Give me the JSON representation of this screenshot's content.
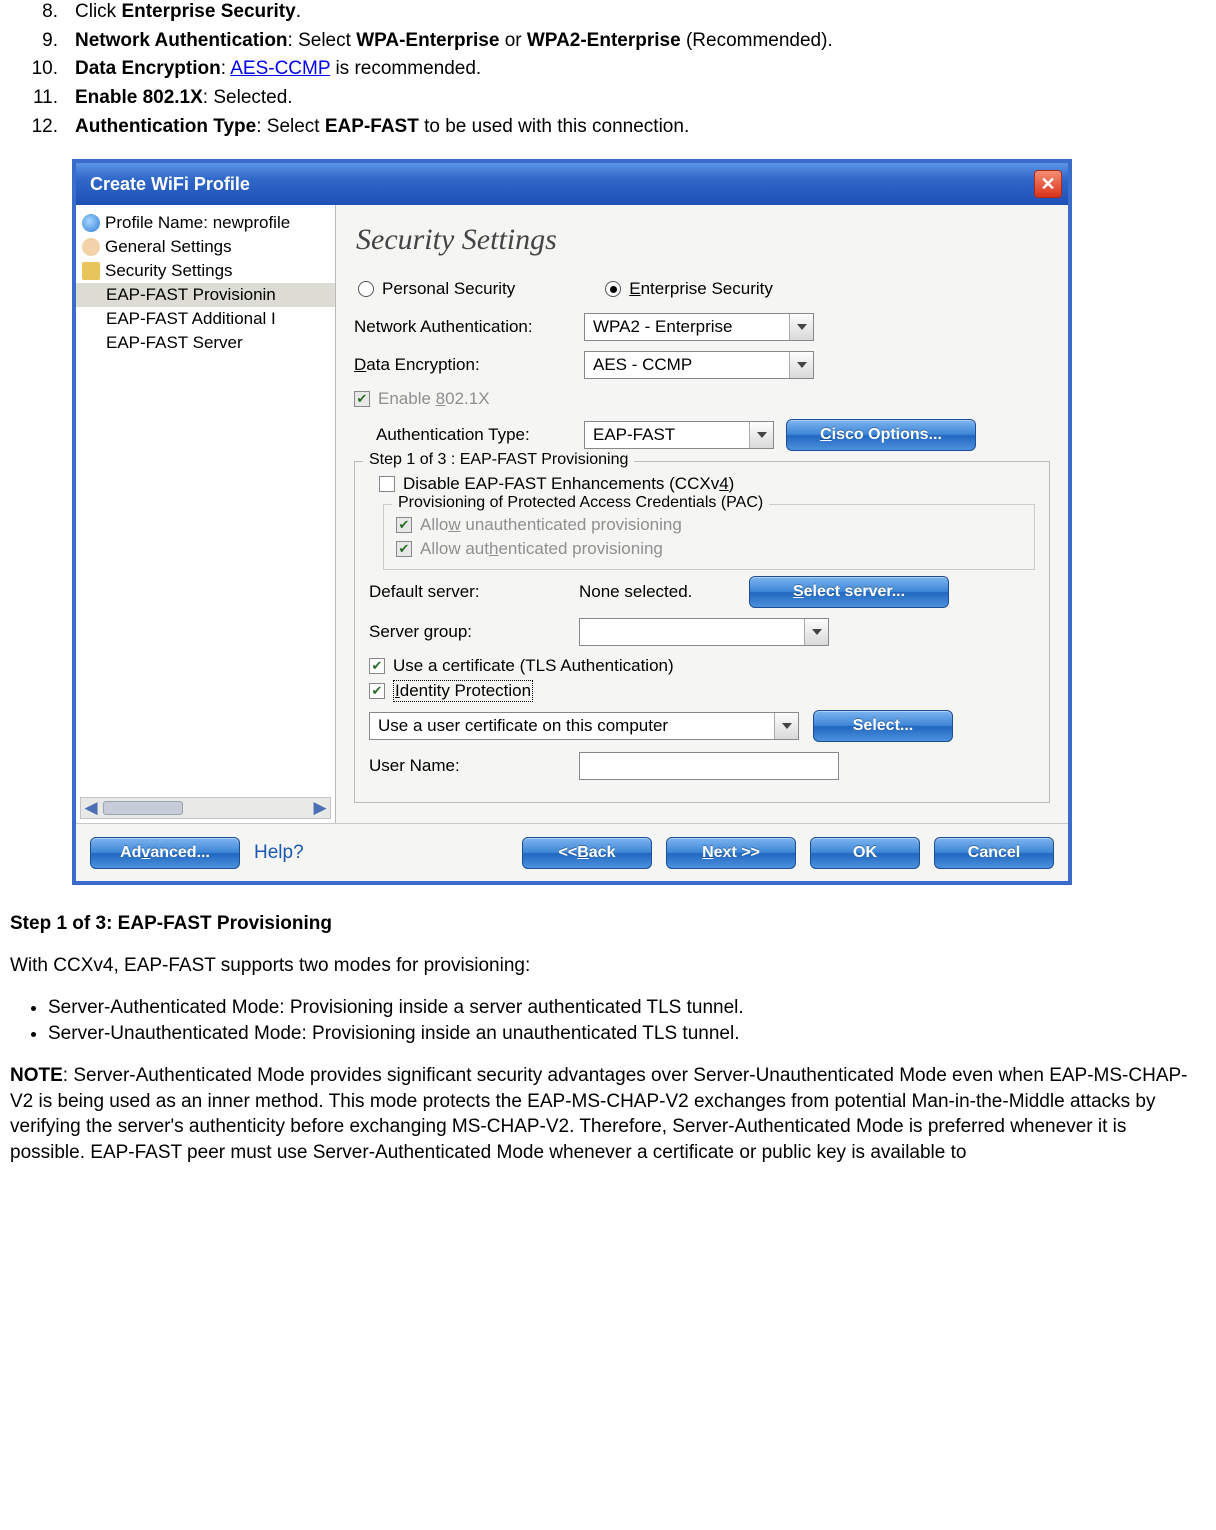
{
  "steps": {
    "s8": {
      "num": "8.",
      "pre": "Click ",
      "bold": "Enterprise Security",
      "post": "."
    },
    "s9": {
      "num": "9.",
      "bold1": "Network Authentication",
      "mid": ": Select ",
      "bold2": "WPA-Enterprise",
      "or": " or ",
      "bold3": "WPA2-Enterprise",
      "tail": " (Recommended)."
    },
    "s10": {
      "num": "10.",
      "bold": "Data Encryption",
      "mid": ": ",
      "link": "AES-CCMP",
      "tail": " is recommended."
    },
    "s11": {
      "num": "11.",
      "bold": "Enable 802.1X",
      "tail": ": Selected."
    },
    "s12": {
      "num": "12.",
      "bold1": "Authentication Type",
      "mid": ": Select ",
      "bold2": "EAP-FAST",
      "tail": " to be used with this connection."
    }
  },
  "dialog": {
    "title": "Create WiFi Profile",
    "tree": {
      "profile": "Profile Name: newprofile",
      "general": "General Settings",
      "security": "Security Settings",
      "eap_prov": "EAP-FAST Provisionin",
      "eap_add": "EAP-FAST Additional I",
      "eap_srv": "EAP-FAST Server"
    },
    "heading": "Security Settings",
    "radios": {
      "personal": "Personal Security",
      "enterprise": "Enterprise Security"
    },
    "labels": {
      "net_auth": "Network Authentication:",
      "data_enc": "Data Encryption:",
      "enable8021x": "Enable 802.1X",
      "auth_type": "Authentication Type:",
      "cisco_btn": "Cisco Options...",
      "step_legend": "Step 1 of 3 : EAP-FAST Provisioning",
      "disable_enh": "Disable EAP-FAST Enhancements (CCXv4)",
      "pac_legend": "Provisioning of Protected Access Credentials (PAC)",
      "allow_unauth": "Allow unauthenticated provisioning",
      "allow_auth": "Allow authenticated provisioning",
      "default_server": "Default server:",
      "none_selected": "None selected.",
      "select_server_btn": "Select server...",
      "server_group": "Server group:",
      "use_cert": "Use a certificate (TLS Authentication)",
      "identity_prot": "Identity Protection",
      "cert_dropdown": "Use a user certificate on this computer",
      "select_btn": "Select...",
      "user_name": "User Name:"
    },
    "values": {
      "net_auth": "WPA2 - Enterprise",
      "data_enc": "AES - CCMP",
      "auth_type": "EAP-FAST"
    },
    "bottom": {
      "advanced": "Advanced...",
      "help": "Help?",
      "back": "<< Back",
      "next": "Next >>",
      "ok": "OK",
      "cancel": "Cancel"
    }
  },
  "after": {
    "h": "Step 1 of 3: EAP-FAST Provisioning",
    "p1": "With CCXv4, EAP-FAST supports two modes for provisioning:",
    "b1": "Server-Authenticated Mode: Provisioning inside a server authenticated TLS tunnel.",
    "b2": "Server-Unauthenticated Mode: Provisioning inside an unauthenticated TLS tunnel.",
    "note_label": "NOTE",
    "note_body": ": Server-Authenticated Mode provides significant security advantages over Server-Unauthenticated Mode even when EAP-MS-CHAP-V2 is being used as an inner method. This mode protects the EAP-MS-CHAP-V2 exchanges from potential Man-in-the-Middle attacks by verifying the server's authenticity before exchanging MS-CHAP-V2. Therefore, Server-Authenticated Mode is preferred whenever it is possible. EAP-FAST peer must use Server-Authenticated Mode whenever a certificate or public key is available to"
  }
}
